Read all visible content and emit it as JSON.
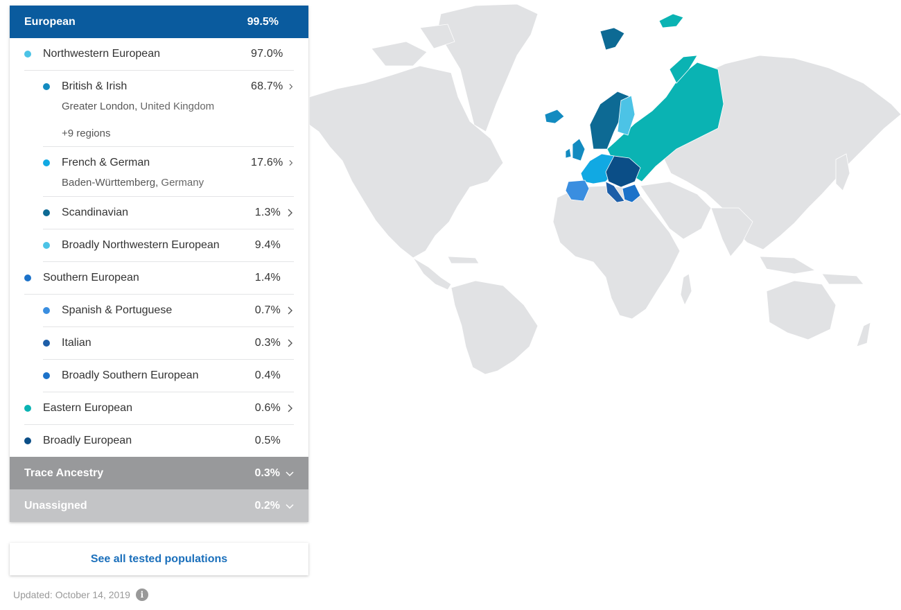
{
  "panel": {
    "header": {
      "label": "European",
      "percent": "99.5%"
    },
    "rows": [
      {
        "id": "nw",
        "level": 1,
        "label": "Northwestern European",
        "percent": "97.0%",
        "color": "#4cc3e6",
        "chevron": false
      },
      {
        "id": "bi",
        "level": 2,
        "label": "British & Irish",
        "percent": "68.7%",
        "color": "#138bc0",
        "chevron": true,
        "sub_region": "Greater London",
        "sub_country": "United Kingdom",
        "sub_more": "+9 regions"
      },
      {
        "id": "fg",
        "level": 2,
        "label": "French & German",
        "percent": "17.6%",
        "color": "#11a9e3",
        "chevron": true,
        "sub_region": "Baden-Württemberg",
        "sub_country": "Germany"
      },
      {
        "id": "sc",
        "level": 2,
        "label": "Scandinavian",
        "percent": "1.3%",
        "color": "#0d6a94",
        "chevron": true
      },
      {
        "id": "bnw",
        "level": 2,
        "label": "Broadly Northwestern European",
        "percent": "9.4%",
        "color": "#4cc3e6",
        "chevron": false
      },
      {
        "id": "se",
        "level": 1,
        "label": "Southern European",
        "percent": "1.4%",
        "color": "#1c72c9",
        "chevron": false
      },
      {
        "id": "sp",
        "level": 2,
        "label": "Spanish & Portuguese",
        "percent": "0.7%",
        "color": "#3a8ee0",
        "chevron": true
      },
      {
        "id": "it",
        "level": 2,
        "label": "Italian",
        "percent": "0.3%",
        "color": "#1d5ea8",
        "chevron": true
      },
      {
        "id": "bse",
        "level": 2,
        "label": "Broadly Southern European",
        "percent": "0.4%",
        "color": "#1c72c9",
        "chevron": false
      },
      {
        "id": "ee",
        "level": 1,
        "label": "Eastern European",
        "percent": "0.6%",
        "color": "#0ab3b3",
        "chevron": true
      },
      {
        "id": "be",
        "level": 1,
        "label": "Broadly European",
        "percent": "0.5%",
        "color": "#0b4e87",
        "chevron": false
      }
    ],
    "trace": {
      "label": "Trace Ancestry",
      "percent": "0.3%"
    },
    "unassigned": {
      "label": "Unassigned",
      "percent": "0.2%"
    }
  },
  "see_all_label": "See all tested populations",
  "updated_text": "Updated: October 14, 2019",
  "icons": {
    "info": "info-icon",
    "chevron_right": "chevron-right-icon",
    "chevron_down": "chevron-down-icon"
  },
  "colors": {
    "header_blue": "#0a5b9e",
    "trace_gray": "#98999b",
    "unassigned_gray": "#c3c4c6",
    "link_blue": "#1a6fbb",
    "map_land": "#e1e2e4"
  }
}
